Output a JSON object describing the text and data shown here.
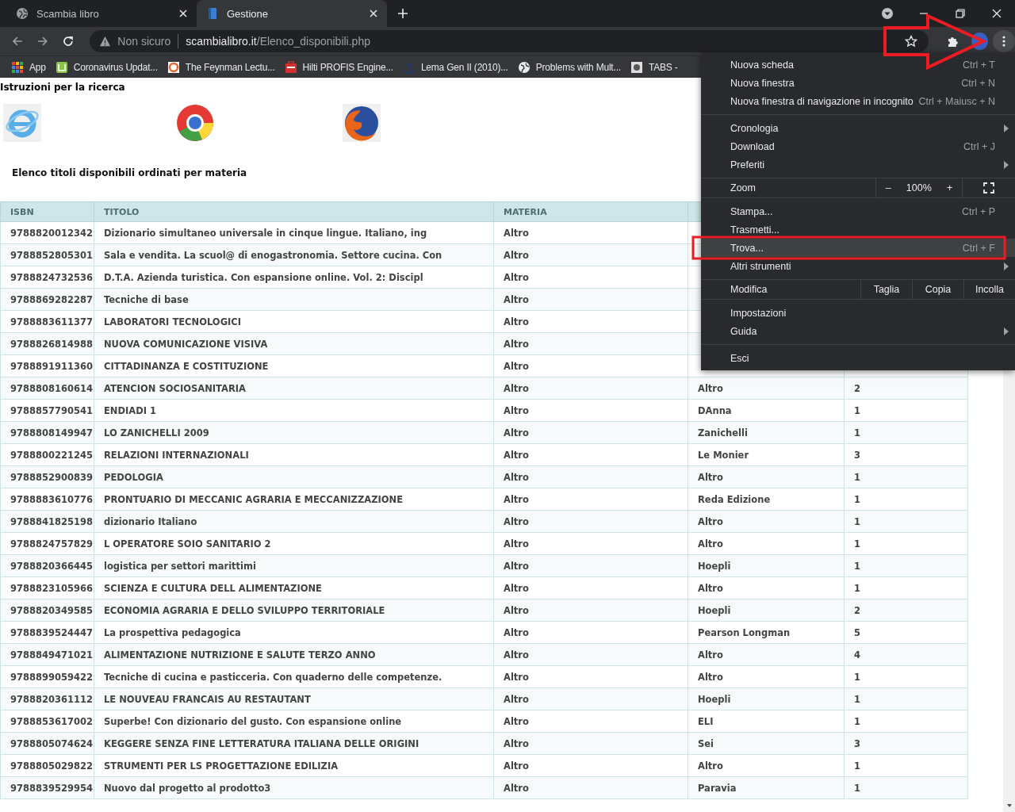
{
  "browser_tabs": [
    {
      "title": "Scambia libro",
      "selected": false
    },
    {
      "title": "Gestione",
      "selected": true
    }
  ],
  "address_bar": {
    "security": "Non sicuro",
    "domain": "scambialibro.it",
    "path": "/Elenco_disponibili.php"
  },
  "bookmarks": [
    "App",
    "Coronavirus Updat...",
    "The Feynman Lectu...",
    "Hilti PROFIS Engine...",
    "Lema Gen II (2010)...",
    "Problems with Mult...",
    "TABS -"
  ],
  "page": {
    "instructions": "Istruzioni per la ricerca",
    "heading": "Elenco titoli disponibili ordinati per materia"
  },
  "table": {
    "columns": [
      "ISBN",
      "TITOLO",
      "MATERIA"
    ],
    "rows": [
      [
        "9788820012342",
        "Dizionario simultaneo universale in cinque lingue. Italiano, ing",
        "Altro"
      ],
      [
        "9788852805301",
        "Sala e vendita. La scuol@ di enogastronomia. Settore cucina. Con",
        "Altro"
      ],
      [
        "9788824732536",
        "D.T.A. Azienda turistica. Con espansione online. Vol. 2: Discipl",
        "Altro"
      ],
      [
        "9788869282287",
        "Tecniche di base",
        "Altro"
      ],
      [
        "9788883611377",
        "LABORATORI TECNOLOGICI",
        "Altro"
      ],
      [
        "9788826814988",
        "NUOVA COMUNICAZIONE VISIVA",
        "Altro"
      ],
      [
        "9788891911360",
        "CITTADINANZA E COSTITUZIONE",
        "Altro"
      ],
      [
        "9788808160614",
        "ATENCION SOCIOSANITARIA",
        "Altro",
        "Altro",
        "2"
      ],
      [
        "9788857790541",
        "ENDIADI 1",
        "Altro",
        "DAnna",
        "1"
      ],
      [
        "9788808149947",
        "LO ZANICHELLI 2009",
        "Altro",
        "Zanichelli",
        "1"
      ],
      [
        "9788800221245",
        "RELAZIONI INTERNAZIONALI",
        "Altro",
        "Le Monier",
        "3"
      ],
      [
        "9788852900839",
        "PEDOLOGIA",
        "Altro",
        "Altro",
        "1"
      ],
      [
        "9788883610776",
        "PRONTUARIO DI MECCANIC AGRARIA E MECCANIZZAZIONE",
        "Altro",
        "Reda Edizione",
        "1"
      ],
      [
        "9788841825198",
        "dizionario Italiano",
        "Altro",
        "Altro",
        "1"
      ],
      [
        "9788824757829",
        "L OPERATORE SOIO SANITARIO 2",
        "Altro",
        "Altro",
        "1"
      ],
      [
        "9788820366445",
        "logistica per settori marittimi",
        "Altro",
        "Hoepli",
        "1"
      ],
      [
        "9788823105966",
        "SCIENZA E CULTURA DELL ALIMENTAZIONE",
        "Altro",
        "Altro",
        "1"
      ],
      [
        "9788820349585",
        "ECONOMIA AGRARIA E DELLO SVILUPPO TERRITORIALE",
        "Altro",
        "Hoepli",
        "2"
      ],
      [
        "9788839524447",
        "La prospettiva pedagogica",
        "Altro",
        "Pearson Longman",
        "5"
      ],
      [
        "9788849471021",
        "ALIMENTAZIONE NUTRIZIONE E SALUTE TERZO ANNO",
        "Altro",
        "Altro",
        "4"
      ],
      [
        "9788899059422",
        "Tecniche di cucina e pasticceria. Con quaderno delle competenze.",
        "Altro",
        "Altro",
        "1"
      ],
      [
        "9788820361112",
        "LE NOUVEAU FRANCAIS AU RESTAUTANT",
        "Altro",
        "Hoepli",
        "1"
      ],
      [
        "9788853617002",
        "Superbe! Con dizionario del gusto. Con espansione online",
        "Altro",
        "ELI",
        "1"
      ],
      [
        "9788805074624",
        "KEGGERE SENZA FINE LETTERATURA ITALIANA DELLE ORIGINI",
        "Altro",
        "Sei",
        "3"
      ],
      [
        "9788805029822",
        "STRUMENTI PER LS PROGETTAZIONE EDILIZIA",
        "Altro",
        "Altro",
        "1"
      ],
      [
        "9788839529954",
        "Nuovo dal progetto al prodotto3",
        "Altro",
        "Paravia",
        "1"
      ]
    ]
  },
  "menu": {
    "sections": [
      [
        {
          "kind": "item",
          "label": "Nuova scheda",
          "shortcut": "Ctrl + T",
          "submenu": false,
          "highlighted": false
        },
        {
          "kind": "item",
          "label": "Nuova finestra",
          "shortcut": "Ctrl + N",
          "submenu": false,
          "highlighted": false
        },
        {
          "kind": "item",
          "label": "Nuova finestra di navigazione in incognito",
          "shortcut": "Ctrl + Maiusc + N",
          "submenu": false,
          "highlighted": false
        }
      ],
      [
        {
          "kind": "item",
          "label": "Cronologia",
          "submenu": true,
          "highlighted": false
        },
        {
          "kind": "item",
          "label": "Download",
          "shortcut": "Ctrl + J",
          "submenu": false,
          "highlighted": false
        },
        {
          "kind": "item",
          "label": "Preferiti",
          "submenu": true,
          "highlighted": false
        }
      ],
      [
        {
          "kind": "zoom",
          "label": "Zoom",
          "minus": "–",
          "value": "100%",
          "plus": "+"
        }
      ],
      [
        {
          "kind": "item",
          "label": "Stampa...",
          "shortcut": "Ctrl + P",
          "submenu": false,
          "highlighted": false
        },
        {
          "kind": "item",
          "label": "Trasmetti...",
          "submenu": false,
          "highlighted": false
        },
        {
          "kind": "item",
          "label": "Trova...",
          "shortcut": "Ctrl + F",
          "submenu": false,
          "highlighted": true
        },
        {
          "kind": "item",
          "label": "Altri strumenti",
          "submenu": true,
          "highlighted": false
        }
      ],
      [
        {
          "kind": "edit",
          "label": "Modifica",
          "buttons": [
            "Taglia",
            "Copia",
            "Incolla"
          ]
        }
      ],
      [
        {
          "kind": "item",
          "label": "Impostazioni",
          "submenu": false,
          "highlighted": false
        },
        {
          "kind": "item",
          "label": "Guida",
          "submenu": true,
          "highlighted": false
        }
      ],
      [
        {
          "kind": "item",
          "label": "Esci",
          "submenu": false,
          "highlighted": false
        }
      ]
    ]
  }
}
